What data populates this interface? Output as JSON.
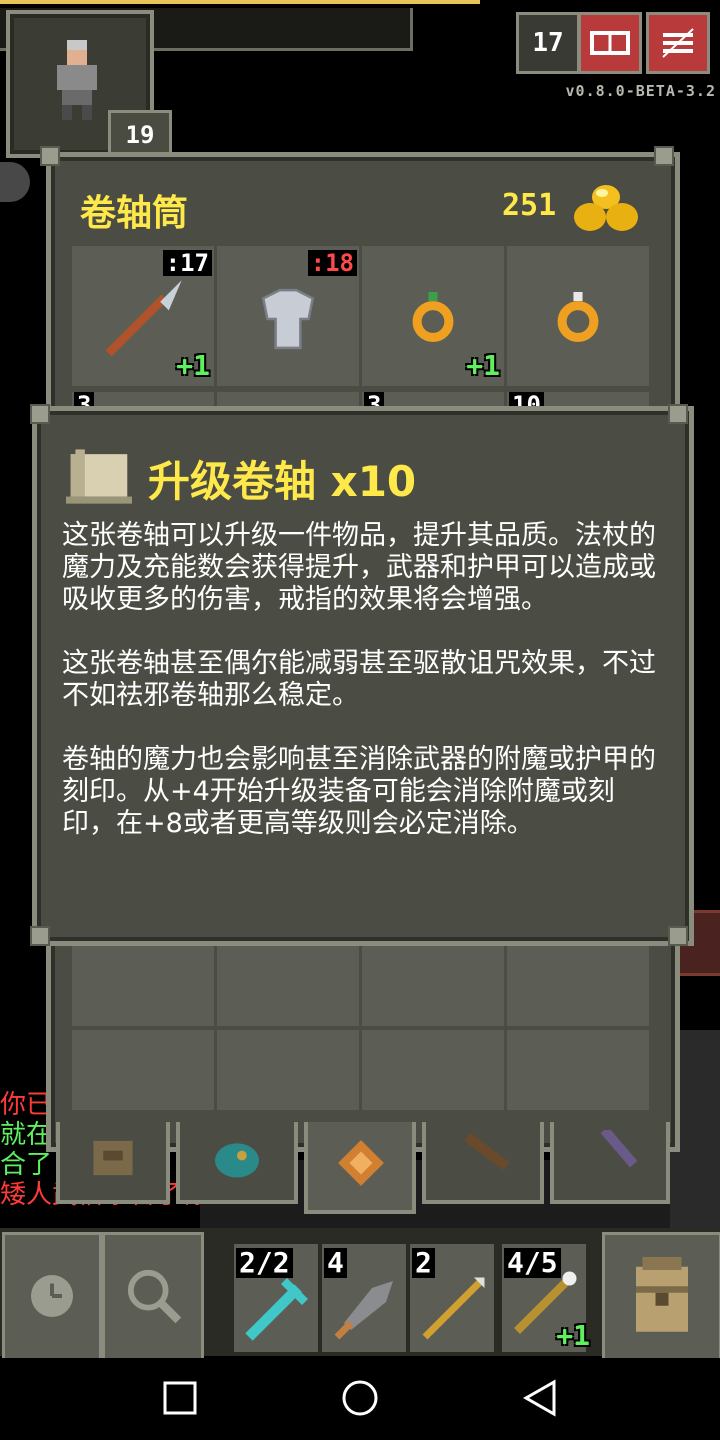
{
  "hud": {
    "hero_level": "19",
    "depth": "17",
    "version": "v0.8.0-BETA-3.2"
  },
  "bag": {
    "title": "卷轴筒",
    "gold": "251",
    "slots": [
      {
        "icon": "spear-icon",
        "qty": ":17",
        "qty_color": "white",
        "level": "+1"
      },
      {
        "icon": "armor-icon",
        "qty": ":18",
        "qty_color": "red",
        "level": ""
      },
      {
        "icon": "ring-icon",
        "qty": "",
        "qty_color": "white",
        "level": "+1"
      },
      {
        "icon": "ring-icon",
        "qty": "",
        "qty_color": "white",
        "level": ""
      }
    ],
    "row2_qty": [
      "3",
      "",
      "3",
      "10"
    ]
  },
  "info": {
    "title": "升级卷轴 x10",
    "desc": [
      "这张卷轴可以升级一件物品，提升其品质。法杖的魔力及充能数会获得提升，武器和护甲可以造成或吸收更多的伤害，戒指的效果将会增强。",
      "这张卷轴甚至偶尔能减弱甚至驱散诅咒效果，不过不如祛邪卷轴那么稳定。",
      "卷轴的魔力也会影响甚至消除武器的附魔或护甲的刻印。从+4开始升级装备可能会消除附魔或刻印，在+8或者更高等级则会必定消除。"
    ]
  },
  "log": [
    {
      "text": "你已",
      "color": "#ff3a3a"
    },
    {
      "text": "就在",
      "color": "#5ef05e"
    },
    {
      "text": "合了",
      "color": "#5ef05e"
    },
    {
      "text": "矮人武僧杀害了你...",
      "color": "#ff3a3a"
    }
  ],
  "quickslots": [
    {
      "icon": "pickaxe-icon",
      "qty": "2/2",
      "level": ""
    },
    {
      "icon": "dart-icon",
      "qty": "4",
      "level": ""
    },
    {
      "icon": "javelin-icon",
      "qty": "2",
      "level": ""
    },
    {
      "icon": "wand-icon",
      "qty": "4/5",
      "level": "+1"
    }
  ],
  "colors": {
    "accent_yellow": "#ffe84a",
    "upgrade_green": "#5ef05e",
    "danger_red": "#ff3a3a"
  }
}
